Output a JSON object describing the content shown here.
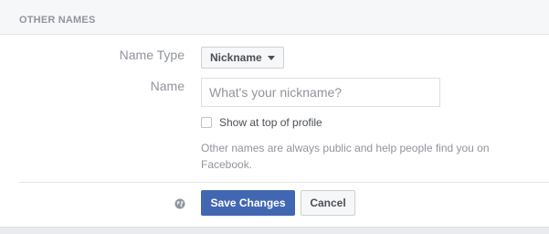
{
  "section": {
    "title": "OTHER NAMES"
  },
  "form": {
    "name_type_label": "Name Type",
    "name_type_value": "Nickname",
    "name_label": "Name",
    "name_placeholder": "What's your nickname?",
    "name_value": "",
    "show_on_profile_label": "Show at top of profile",
    "show_on_profile_checked": false,
    "help_text": "Other names are always public and help people find you on Facebook."
  },
  "actions": {
    "save_label": "Save Changes",
    "cancel_label": "Cancel",
    "privacy_icon": "globe-icon"
  },
  "colors": {
    "primary_button": "#4267b2",
    "muted_text": "#90949c"
  }
}
